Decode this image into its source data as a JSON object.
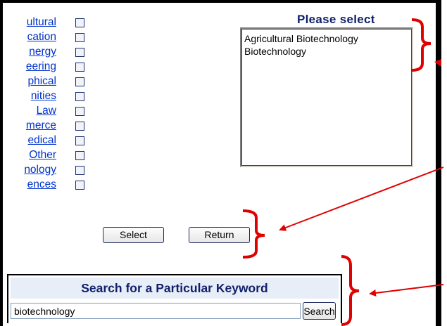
{
  "categories": [
    {
      "label": "ultural",
      "checked": false
    },
    {
      "label": "cation",
      "checked": false
    },
    {
      "label": "nergy",
      "checked": false
    },
    {
      "label": "eering",
      "checked": false
    },
    {
      "label": "phical",
      "checked": false
    },
    {
      "label": "nities",
      "checked": false
    },
    {
      "label": "Law",
      "checked": false
    },
    {
      "label": "merce",
      "checked": false
    },
    {
      "label": "edical",
      "checked": false
    },
    {
      "label": "Other",
      "checked": false
    },
    {
      "label": "nology",
      "checked": false
    },
    {
      "label": "ences",
      "checked": false
    }
  ],
  "selection": {
    "title": "Please select",
    "options": [
      "Agricultural Biotechnology",
      "Biotechnology"
    ]
  },
  "buttons": {
    "select_label": "Select",
    "return_label": "Return"
  },
  "search": {
    "title": "Search for a Particular Keyword",
    "input_value": "biotechnology",
    "button_label": "Search"
  },
  "colors": {
    "link": "#0033cc",
    "heading": "#10206a",
    "annotation": "#e00000"
  }
}
